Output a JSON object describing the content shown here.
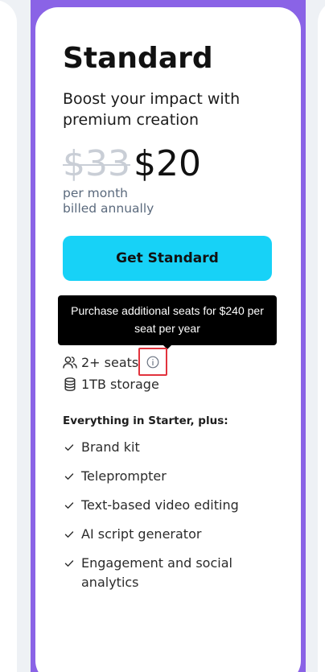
{
  "plan": {
    "name": "Standard",
    "tagline": "Boost your impact with premium creation",
    "price_original": "$33",
    "price_current": "$20",
    "billing_line1": "per month",
    "billing_line2": "billed annually",
    "cta_label": "Get Standard"
  },
  "tooltip": {
    "text": "Purchase additional seats for $240 per seat per year"
  },
  "features": [
    {
      "icon": "users-icon",
      "label": "2+ seats"
    },
    {
      "icon": "database-icon",
      "label": "1TB storage"
    }
  ],
  "includes": {
    "heading": "Everything in Starter, plus:",
    "items": [
      "Brand kit",
      "Teleprompter",
      "Text-based video editing",
      "AI script generator",
      "Engagement and social analytics"
    ]
  },
  "colors": {
    "frame_accent": "#8a63e6",
    "cta_background": "#17d2f7",
    "highlight_outline": "#e2333d",
    "strikethrough_price": "#c9ced6",
    "billing_text": "#5b6a7d"
  }
}
